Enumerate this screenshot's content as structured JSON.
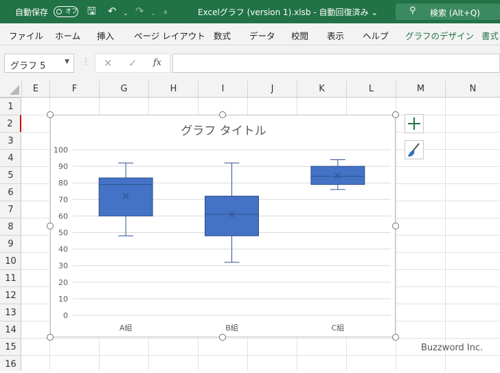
{
  "titlebar": {
    "autosave_label": "自動保存",
    "toggle_text": "オフ",
    "doc_title": "Excelグラフ (version 1).xlsb  -  自動回復済み ⌄",
    "search_label": "検索 (Alt+Q)"
  },
  "ribbon_tabs": [
    "ファイル",
    "ホーム",
    "挿入",
    "ページ レイアウト",
    "数式",
    "データ",
    "校閲",
    "表示",
    "ヘルプ",
    "グラフのデザイン",
    "書式"
  ],
  "formula_bar": {
    "name_box": "グラフ 5",
    "fx": "fx",
    "cancel": "✕",
    "enter": "✓",
    "value": ""
  },
  "columns": [
    "E",
    "F",
    "G",
    "H",
    "I",
    "J",
    "K",
    "L",
    "M",
    "N"
  ],
  "rows": [
    "1",
    "2",
    "3",
    "4",
    "5",
    "6",
    "7",
    "8",
    "9",
    "10",
    "11",
    "12",
    "13",
    "14",
    "15",
    "16"
  ],
  "chart_data": {
    "type": "boxplot",
    "title": "グラフ タイトル",
    "categories": [
      "A組",
      "B組",
      "C組"
    ],
    "ylim": [
      0,
      100
    ],
    "yticks": [
      0,
      10,
      20,
      30,
      40,
      50,
      60,
      70,
      80,
      90,
      100
    ],
    "grid": true,
    "series": [
      {
        "min": 48,
        "q1": 60,
        "median": 79,
        "q3": 83,
        "max": 92,
        "mean": 72
      },
      {
        "min": 32,
        "q1": 48,
        "median": 61,
        "q3": 72,
        "max": 92,
        "mean": 61
      },
      {
        "min": 76,
        "q1": 79,
        "median": 84,
        "q3": 90,
        "max": 94,
        "mean": 84.5
      }
    ],
    "box_color": "#4472C4",
    "stroke_color": "#2F528F"
  },
  "watermark": "Buzzword Inc."
}
